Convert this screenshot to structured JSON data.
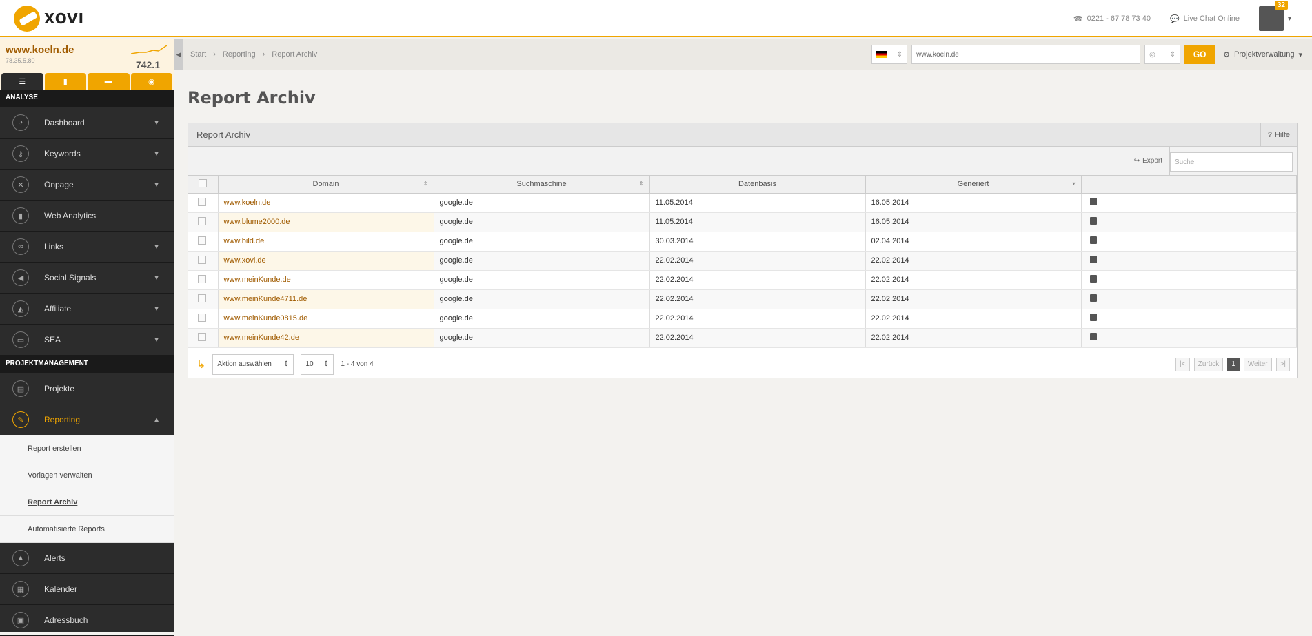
{
  "header": {
    "logo": "XOVI",
    "phone": "0221 - 67 78 73 40",
    "chat": "Live Chat Online",
    "badge": "32"
  },
  "project": {
    "domain": "www.koeln.de",
    "ip": "78.35.5.80",
    "score": "742.1"
  },
  "sidebar": {
    "analyse_label": "ANALYSE",
    "analyse": [
      {
        "label": "Dashboard",
        "icon": "gauge-icon"
      },
      {
        "label": "Keywords",
        "icon": "key-icon"
      },
      {
        "label": "Onpage",
        "icon": "wrench-icon"
      },
      {
        "label": "Web Analytics",
        "icon": "bar-chart-icon"
      },
      {
        "label": "Links",
        "icon": "link-icon"
      },
      {
        "label": "Social Signals",
        "icon": "megaphone-icon"
      },
      {
        "label": "Affiliate",
        "icon": "users-icon"
      },
      {
        "label": "SEA",
        "icon": "billboard-icon"
      }
    ],
    "pm_label": "PROJEKTMANAGEMENT",
    "pm": [
      {
        "label": "Projekte"
      },
      {
        "label": "Reporting"
      }
    ],
    "sub": [
      "Report erstellen",
      "Vorlagen verwalten",
      "Report Archiv",
      "Automatisierte Reports"
    ],
    "rest": [
      {
        "label": "Alerts"
      },
      {
        "label": "Kalender"
      },
      {
        "label": "Adressbuch"
      }
    ]
  },
  "breadcrumb": [
    "Start",
    "Reporting",
    "Report Archiv"
  ],
  "search": {
    "url": "www.koeln.de",
    "go": "GO",
    "manage": "Projektverwaltung",
    "placeholder": "Suche"
  },
  "page": {
    "title": "Report Archiv",
    "panel_title": "Report Archiv",
    "help": "Hilfe",
    "export": "Export"
  },
  "table": {
    "headers": [
      "Domain",
      "Suchmaschine",
      "Datenbasis",
      "Generiert"
    ],
    "rows": [
      [
        "www.koeln.de",
        "google.de",
        "11.05.2014",
        "16.05.2014"
      ],
      [
        "www.blume2000.de",
        "google.de",
        "11.05.2014",
        "16.05.2014"
      ],
      [
        "www.bild.de",
        "google.de",
        "30.03.2014",
        "02.04.2014"
      ],
      [
        "www.xovi.de",
        "google.de",
        "22.02.2014",
        "22.02.2014"
      ],
      [
        "www.meinKunde.de",
        "google.de",
        "22.02.2014",
        "22.02.2014"
      ],
      [
        "www.meinKunde4711.de",
        "google.de",
        "22.02.2014",
        "22.02.2014"
      ],
      [
        "www.meinKunde0815.de",
        "google.de",
        "22.02.2014",
        "22.02.2014"
      ],
      [
        "www.meinKunde42.de",
        "google.de",
        "22.02.2014",
        "22.02.2014"
      ]
    ]
  },
  "footer": {
    "action": "Aktion auswählen",
    "per_page": "10",
    "count": "1 - 4 von 4",
    "first": "|<",
    "prev": "Zurück",
    "page": "1",
    "next": "Weiter",
    "last": ">|"
  }
}
